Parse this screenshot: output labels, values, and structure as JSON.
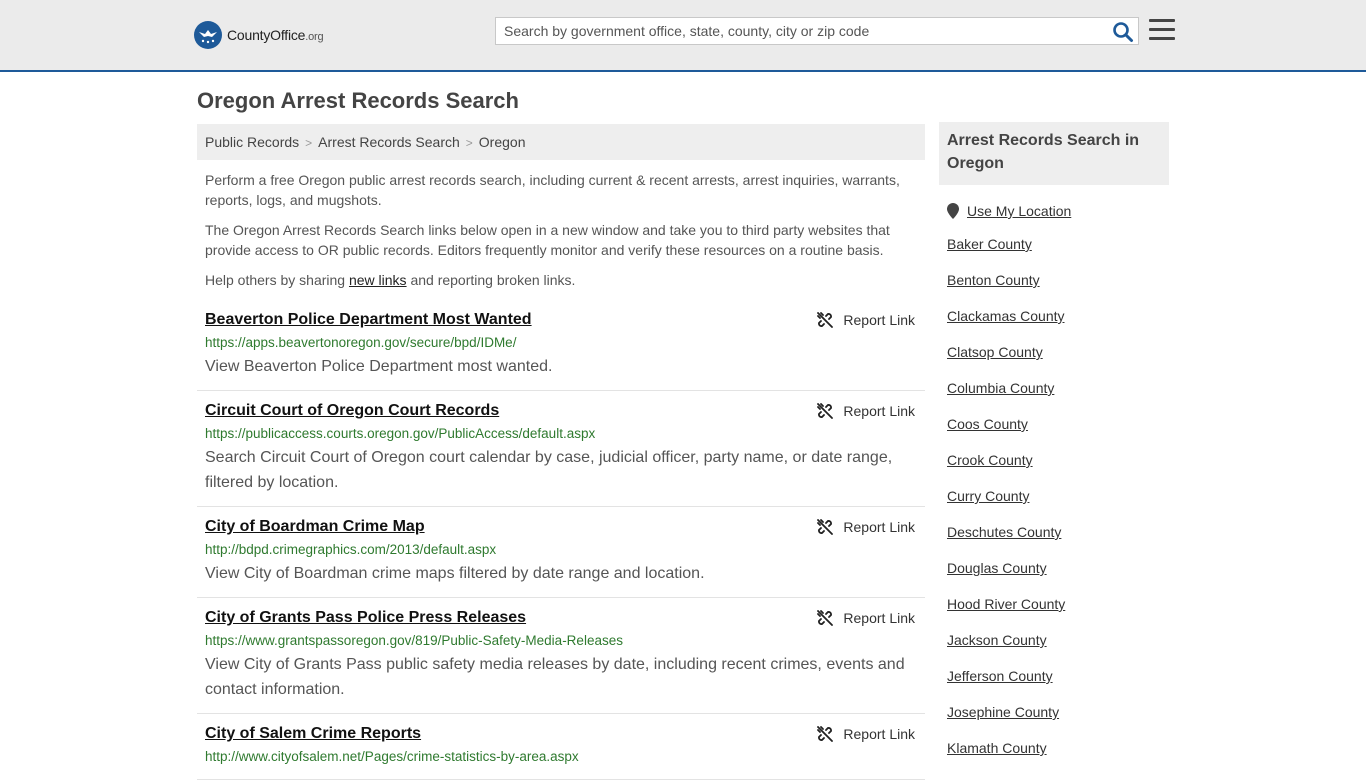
{
  "header": {
    "logo_main": "CountyOffice",
    "logo_suffix": ".org",
    "search_placeholder": "Search by government office, state, county, city or zip code"
  },
  "page": {
    "title": "Oregon Arrest Records Search"
  },
  "breadcrumb": [
    "Public Records",
    "Arrest Records Search",
    "Oregon"
  ],
  "intro": {
    "p1": "Perform a free Oregon public arrest records search, including current & recent arrests, arrest inquiries, warrants, reports, logs, and mugshots.",
    "p2": "The Oregon Arrest Records Search links below open in a new window and take you to third party websites that provide access to OR public records. Editors frequently monitor and verify these resources on a routine basis.",
    "p3_before": "Help others by sharing ",
    "p3_link": "new links",
    "p3_after": " and reporting broken links."
  },
  "report_label": "Report Link",
  "results": [
    {
      "title": "Beaverton Police Department Most Wanted",
      "url": "https://apps.beavertonoregon.gov/secure/bpd/IDMe/",
      "desc": "View Beaverton Police Department most wanted."
    },
    {
      "title": "Circuit Court of Oregon Court Records",
      "url": "https://publicaccess.courts.oregon.gov/PublicAccess/default.aspx",
      "desc": "Search Circuit Court of Oregon court calendar by case, judicial officer, party name, or date range, filtered by location."
    },
    {
      "title": "City of Boardman Crime Map",
      "url": "http://bdpd.crimegraphics.com/2013/default.aspx",
      "desc": "View City of Boardman crime maps filtered by date range and location."
    },
    {
      "title": "City of Grants Pass Police Press Releases",
      "url": "https://www.grantspassoregon.gov/819/Public-Safety-Media-Releases",
      "desc": "View City of Grants Pass public safety media releases by date, including recent crimes, events and contact information."
    },
    {
      "title": "City of Salem Crime Reports",
      "url": "http://www.cityofsalem.net/Pages/crime-statistics-by-area.aspx",
      "desc": ""
    }
  ],
  "sidebar": {
    "title": "Arrest Records Search in Oregon",
    "location_label": "Use My Location",
    "counties": [
      "Baker County",
      "Benton County",
      "Clackamas County",
      "Clatsop County",
      "Columbia County",
      "Coos County",
      "Crook County",
      "Curry County",
      "Deschutes County",
      "Douglas County",
      "Hood River County",
      "Jackson County",
      "Jefferson County",
      "Josephine County",
      "Klamath County"
    ]
  },
  "colors": {
    "brand_blue": "#1e5a99",
    "url_green": "#2f7a2f"
  }
}
